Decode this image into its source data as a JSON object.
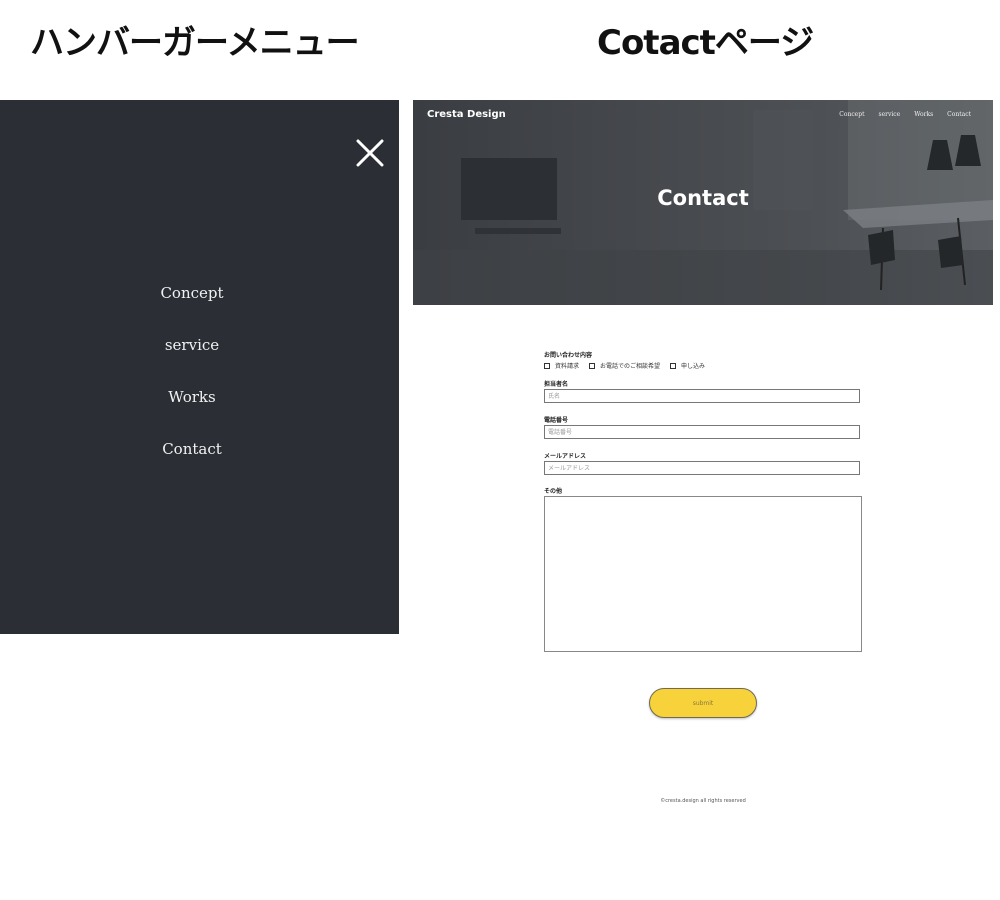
{
  "headings": {
    "left": "ハンバーガーメニュー",
    "right": "Cotactページ"
  },
  "menu": {
    "close_icon": "close-icon",
    "items": [
      "Concept",
      "service",
      "Works",
      "Contact"
    ]
  },
  "contact": {
    "brand": "Cresta Design",
    "nav": [
      "Concept",
      "service",
      "Works",
      "Contact"
    ],
    "hero_title": "Contact",
    "form": {
      "inquiry_label": "お問い合わせ内容",
      "options": [
        "資料請求",
        "お電話でのご相談希望",
        "申し込み"
      ],
      "name_label": "担当者名",
      "name_placeholder": "氏名",
      "phone_label": "電話番号",
      "phone_placeholder": "電話番号",
      "email_label": "メールアドレス",
      "email_placeholder": "メールアドレス",
      "other_label": "その他",
      "submit_label": "submit"
    },
    "footer": "©cresta.design all rights reserved"
  },
  "colors": {
    "menu_bg": "#2b2f35",
    "submit_bg": "#f7d23b"
  }
}
